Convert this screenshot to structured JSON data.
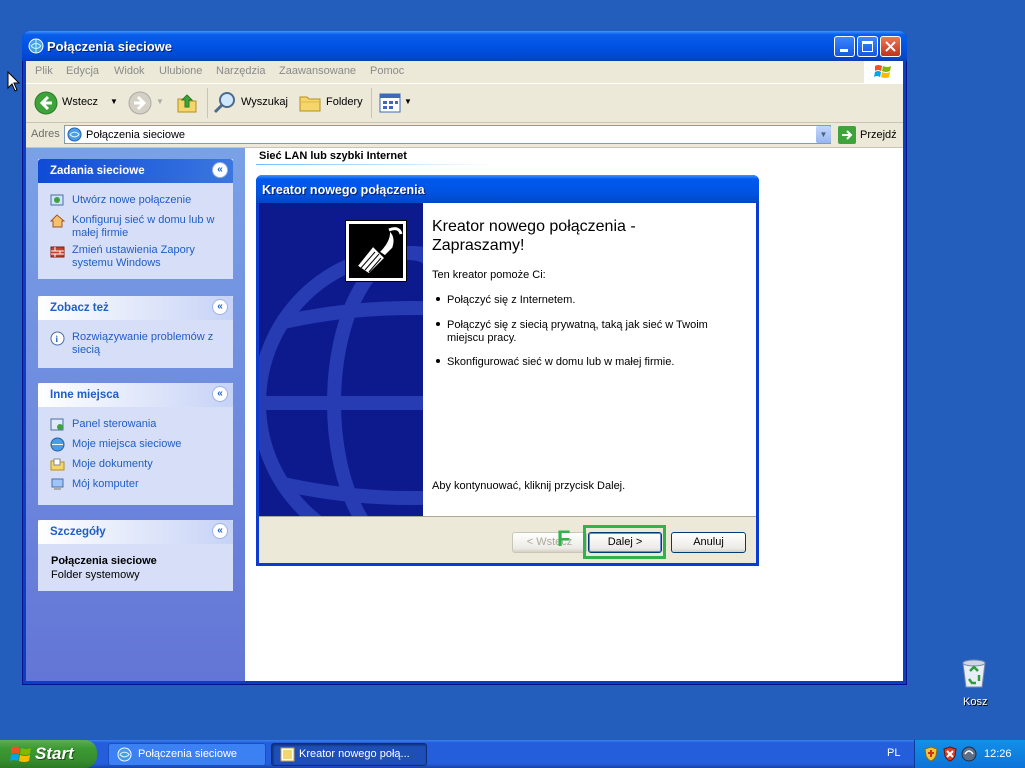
{
  "window": {
    "title": "Połączenia sieciowe",
    "menu": [
      "Plik",
      "Edycja",
      "Widok",
      "Ulubione",
      "Narzędzia",
      "Zaawansowane",
      "Pomoc"
    ],
    "toolbar": {
      "back": "Wstecz",
      "search": "Wyszukaj",
      "folders": "Foldery"
    },
    "address": {
      "label": "Adres",
      "value": "Połączenia sieciowe",
      "go": "Przejdź"
    },
    "group_header": "Sieć LAN lub szybki Internet"
  },
  "left_pane": {
    "network_tasks": {
      "title": "Zadania sieciowe",
      "items": [
        "Utwórz nowe połączenie",
        "Konfiguruj sieć w domu lub w małej firmie",
        "Zmień ustawienia Zapory systemu Windows"
      ]
    },
    "see_also": {
      "title": "Zobacz też",
      "items": [
        "Rozwiązywanie problemów z siecią"
      ]
    },
    "other_places": {
      "title": "Inne miejsca",
      "items": [
        "Panel sterowania",
        "Moje miejsca sieciowe",
        "Moje dokumenty",
        "Mój komputer"
      ]
    },
    "details": {
      "title": "Szczegóły",
      "name": "Połączenia sieciowe",
      "type": "Folder systemowy"
    }
  },
  "wizard": {
    "title": "Kreator nowego połączenia",
    "heading": "Kreator nowego połączenia - Zapraszamy!",
    "intro": "Ten kreator pomoże Ci:",
    "bullets": [
      "Połączyć się z Internetem.",
      "Połączyć się z siecią prywatną, taką jak sieć w Twoim miejscu pracy.",
      "Skonfigurować sieć w domu lub w małej firmie."
    ],
    "continue_text": "Aby kontynuować, kliknij przycisk Dalej.",
    "buttons": {
      "back": "< Wstecz",
      "next": "Dalej >",
      "cancel": "Anuluj"
    },
    "marker": "F"
  },
  "desktop": {
    "recycle_bin": "Kosz"
  },
  "taskbar": {
    "start": "Start",
    "tasks": [
      "Połączenia sieciowe",
      "Kreator nowego połą..."
    ],
    "language": "PL",
    "clock": "12:26"
  },
  "colors": {
    "desktop": "#245ebd",
    "title_blue": "#0054e3",
    "link_blue": "#215dc6",
    "marker_green": "#2fb34a"
  }
}
